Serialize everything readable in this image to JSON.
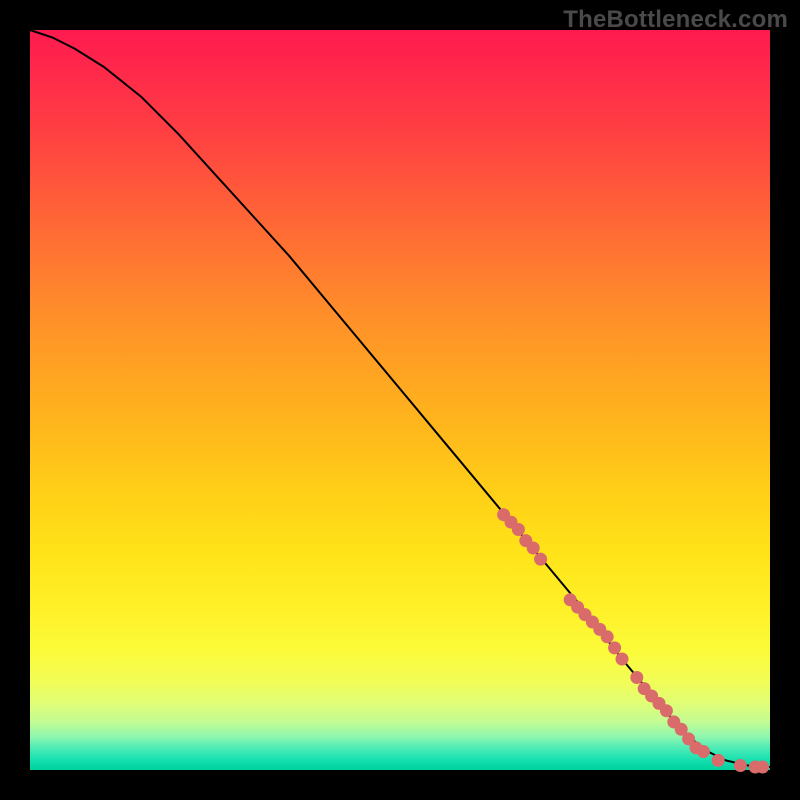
{
  "watermark": "TheBottleneck.com",
  "colors": {
    "point": "#d96b6b",
    "curve": "#000000",
    "gradient_top": "#ff1a4e",
    "gradient_bottom": "#00d19d",
    "page_bg": "#000000"
  },
  "chart_data": {
    "type": "line",
    "title": "",
    "xlabel": "",
    "ylabel": "",
    "xlim": [
      0,
      100
    ],
    "ylim": [
      0,
      100
    ],
    "grid": false,
    "legend": false,
    "curve": {
      "x": [
        0,
        3,
        6,
        10,
        15,
        20,
        25,
        30,
        35,
        40,
        45,
        50,
        55,
        60,
        65,
        70,
        75,
        80,
        85,
        88,
        91,
        94,
        97,
        100
      ],
      "y": [
        100,
        99,
        97.5,
        95,
        91,
        86,
        80.5,
        75,
        69.5,
        63.5,
        57.5,
        51.5,
        45.5,
        39.5,
        33.5,
        27.5,
        21.5,
        15,
        9,
        5.5,
        2.8,
        1.3,
        0.6,
        0.4
      ]
    },
    "series": [
      {
        "name": "points",
        "type": "scatter",
        "x": [
          64,
          65,
          66,
          67,
          68,
          69,
          73,
          74,
          75,
          76,
          77,
          78,
          79,
          80,
          82,
          83,
          84,
          85,
          86,
          87,
          88,
          89,
          90,
          91,
          93,
          96,
          98,
          99
        ],
        "y": [
          34.5,
          33.5,
          32.5,
          31,
          30,
          28.5,
          23,
          22,
          21,
          20,
          19,
          18,
          16.5,
          15,
          12.5,
          11,
          10,
          9,
          8,
          6.5,
          5.5,
          4.2,
          3,
          2.5,
          1.3,
          0.6,
          0.4,
          0.4
        ]
      }
    ]
  }
}
